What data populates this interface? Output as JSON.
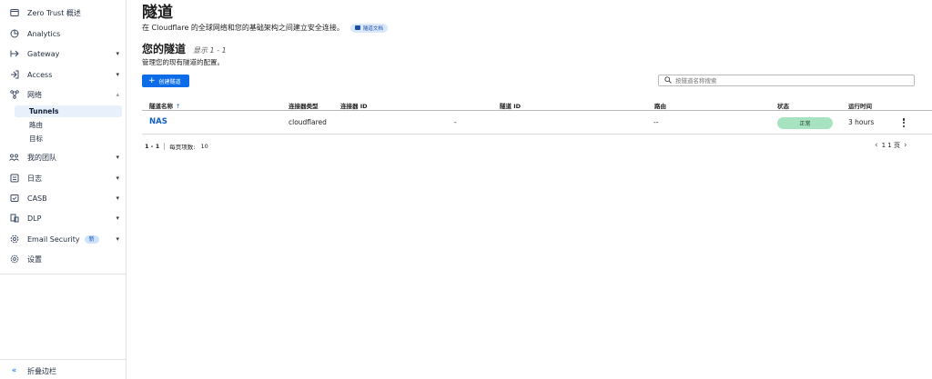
{
  "sidebar": {
    "items": [
      {
        "label": "Zero Trust 概述",
        "icon": "overview-icon",
        "caret": ""
      },
      {
        "label": "Analytics",
        "icon": "analytics-icon",
        "caret": ""
      },
      {
        "label": "Gateway",
        "icon": "gateway-icon",
        "caret": "▾"
      },
      {
        "label": "Access",
        "icon": "access-icon",
        "caret": "▾"
      },
      {
        "label": "网络",
        "icon": "network-icon",
        "caret": "▴"
      },
      {
        "label": "我的团队",
        "icon": "team-icon",
        "caret": "▾"
      },
      {
        "label": "日志",
        "icon": "logs-icon",
        "caret": "▾"
      },
      {
        "label": "CASB",
        "icon": "casb-icon",
        "caret": "▾"
      },
      {
        "label": "DLP",
        "icon": "dlp-icon",
        "caret": "▾"
      },
      {
        "label": "Email Security",
        "icon": "email-security-icon",
        "caret": "▾",
        "badge": "新"
      },
      {
        "label": "设置",
        "icon": "settings-icon",
        "caret": ""
      }
    ],
    "network_sub": [
      "Tunnels",
      "路由",
      "目标"
    ],
    "collapse_label": "折叠边栏"
  },
  "page": {
    "title": "隧道",
    "description": "在 Cloudflare 的全球网络和您的基础架构之间建立安全连接。",
    "doc_chip": "隧道文档",
    "section_title": "您的隧道",
    "section_count": "显示 1 - 1",
    "section_desc": "管理您的现有隧道的配置。",
    "create_button": "创建隧道",
    "search_placeholder": "按隧道名称搜索"
  },
  "table": {
    "columns": [
      "隧道名称",
      "连接器类型",
      "连接器 ID",
      "隧道 ID",
      "路由",
      "状态",
      "运行时间"
    ],
    "sort_indicator": "↑",
    "rows": [
      {
        "name": "NAS",
        "connector_type": "cloudflared",
        "connector_id": "-",
        "tunnel_id": "",
        "route": "--",
        "status": "正常",
        "uptime": "3 hours"
      }
    ]
  },
  "pagination": {
    "range": "1 - 1",
    "per_page_label": "每页项数:",
    "per_page_value": "10",
    "page_text": "1 1 页"
  },
  "colors": {
    "accent": "#0d6ce8",
    "status_ok_bg": "#a8e3c1",
    "link": "#0d5ecb"
  }
}
